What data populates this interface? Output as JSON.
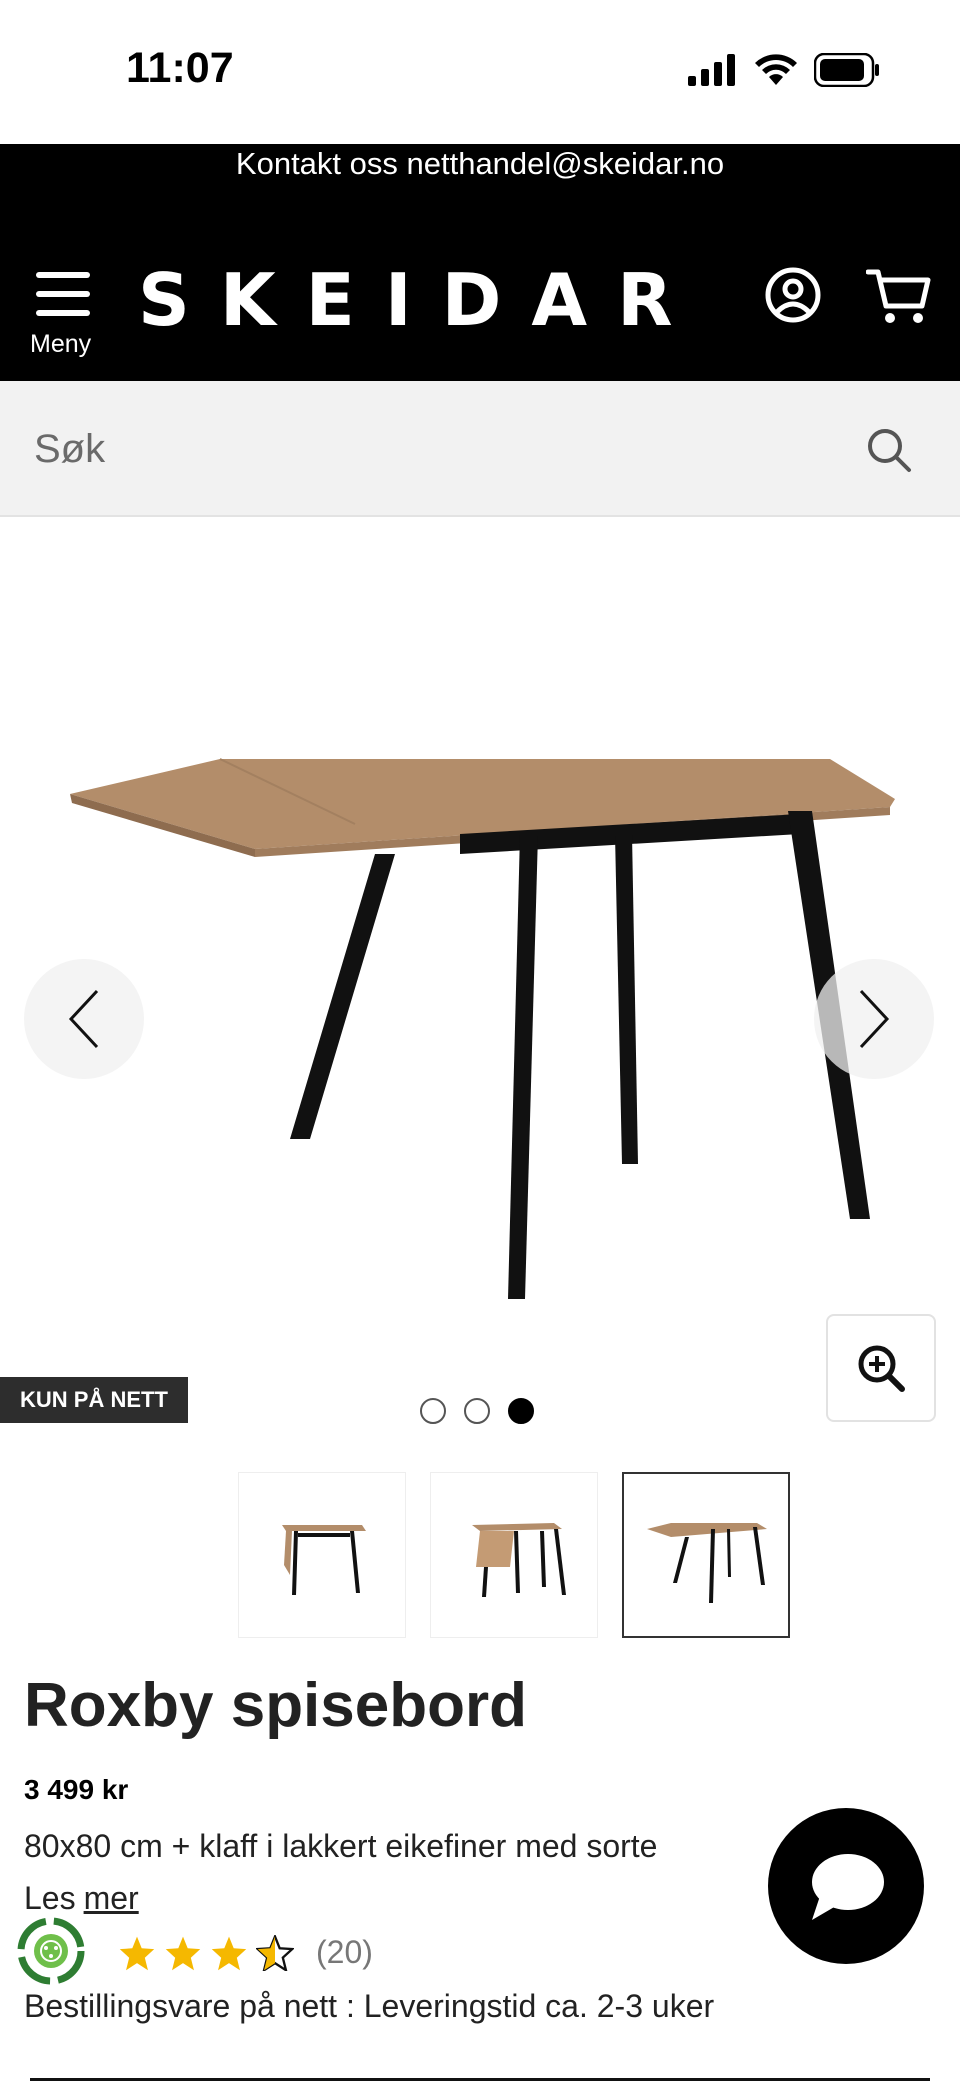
{
  "status_bar": {
    "time": "11:07"
  },
  "contact": {
    "text": "Kontakt oss netthandel@skeidar.no"
  },
  "header": {
    "menu_label": "Meny",
    "logo": "SKEIDAR"
  },
  "search": {
    "placeholder": "Søk"
  },
  "gallery": {
    "badge": "KUN PÅ NETT",
    "slide_count": 3,
    "active_slide": 3
  },
  "thumbnails": {
    "count": 3,
    "selected": 3
  },
  "product": {
    "title": "Roxby spisebord",
    "price": "3 499 kr",
    "description": "80x80 cm + klaff i lakkert eikefiner med sorte",
    "read_more_prefix": "Les",
    "read_more_link": "mer",
    "rating": {
      "value": 3.5,
      "max": 5,
      "count": "(20)"
    },
    "availability": "Bestillingsvare på nett : Leveringstid ca. 2-3 uker"
  },
  "colors": {
    "header_bg": "#000000",
    "search_bg": "#f2f2f2",
    "star": "#f5b800",
    "tabletop": "#b38d6a",
    "legs": "#111111",
    "badge_bg": "#2d2d2d",
    "eco_green": "#2e7d32"
  }
}
